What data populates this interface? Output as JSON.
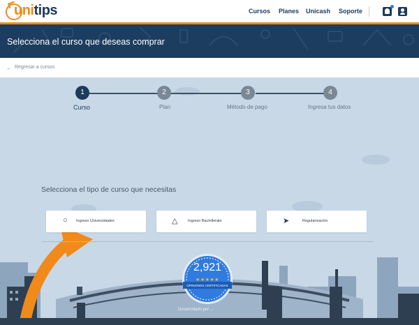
{
  "header": {
    "logo": {
      "prefix": "uni",
      "suffix": "tips"
    },
    "nav": [
      "Cursos",
      "Planes",
      "Unicash",
      "Soporte"
    ],
    "icons": [
      "bell-icon",
      "user-icon"
    ],
    "accent_color": "#f08a1a",
    "brand_color": "#1b3a5c"
  },
  "banner": {
    "title": "Selecciona el curso que deseas comprar"
  },
  "breadcrumb": {
    "back_label": "Regresar a cursos",
    "icon": "arrow-left-icon"
  },
  "steps": [
    {
      "number": "1",
      "label": "Curso",
      "state": "active"
    },
    {
      "number": "2",
      "label": "Plan",
      "state": "todo"
    },
    {
      "number": "3",
      "label": "Método de pago",
      "state": "todo"
    },
    {
      "number": "4",
      "label": "Ingresa tus datos",
      "state": "todo"
    }
  ],
  "course_section": {
    "title": "Selecciona el tipo de curso que necesitas",
    "options": [
      {
        "label": "Ingreso Universidades",
        "icon": "apple-icon"
      },
      {
        "label": "Ingreso Bachillerato",
        "icon": "graduation-cap-icon"
      },
      {
        "label": "Regularización",
        "icon": "rocket-icon"
      }
    ]
  },
  "review_badge": {
    "count": "2,921",
    "stars": "★★★★★",
    "label": "OPINIONES CERTIFICADAS"
  },
  "footer_note": "Desarrollado por ..."
}
